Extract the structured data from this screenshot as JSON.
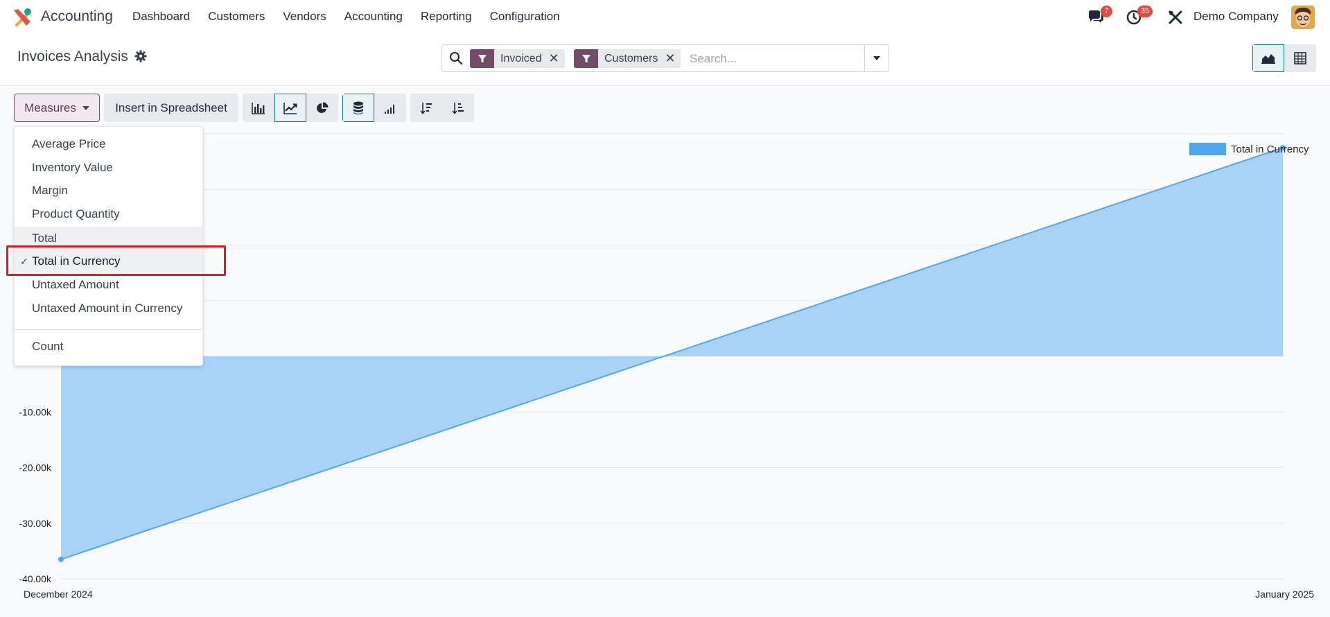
{
  "app": {
    "name": "Accounting",
    "menu": [
      "Dashboard",
      "Customers",
      "Vendors",
      "Accounting",
      "Reporting",
      "Configuration"
    ],
    "messages_badge": "7",
    "activities_badge": "35",
    "company": "Demo Company"
  },
  "control": {
    "title": "Invoices Analysis",
    "search": {
      "facets": [
        "Invoiced",
        "Customers"
      ],
      "placeholder": "Search..."
    }
  },
  "toolbar": {
    "measures_label": "Measures",
    "insert_label": "Insert in Spreadsheet"
  },
  "measures_menu": {
    "items": [
      "Average Price",
      "Inventory Value",
      "Margin",
      "Product Quantity",
      "Total",
      "Total in Currency",
      "Untaxed Amount",
      "Untaxed Amount in Currency"
    ],
    "selected": "Total in Currency",
    "hovered": "Total",
    "count_label": "Count"
  },
  "colors": {
    "brand": "#714b67",
    "accent": "#017e84",
    "series": "#4fa7ee",
    "series_fill": "#a8d3f7",
    "highlight": "#e3191b"
  },
  "chart_data": {
    "type": "area",
    "x": [
      "December 2024",
      "January 2025"
    ],
    "series": [
      {
        "name": "Total in Currency",
        "values": [
          -36500,
          37500
        ]
      }
    ],
    "yticks": [
      "-40.00k",
      "-30.00k",
      "-20.00k",
      "-10.00k",
      "0.00"
    ],
    "ylim": [
      -40000,
      40000
    ],
    "legend": "top-right",
    "grid": true
  }
}
